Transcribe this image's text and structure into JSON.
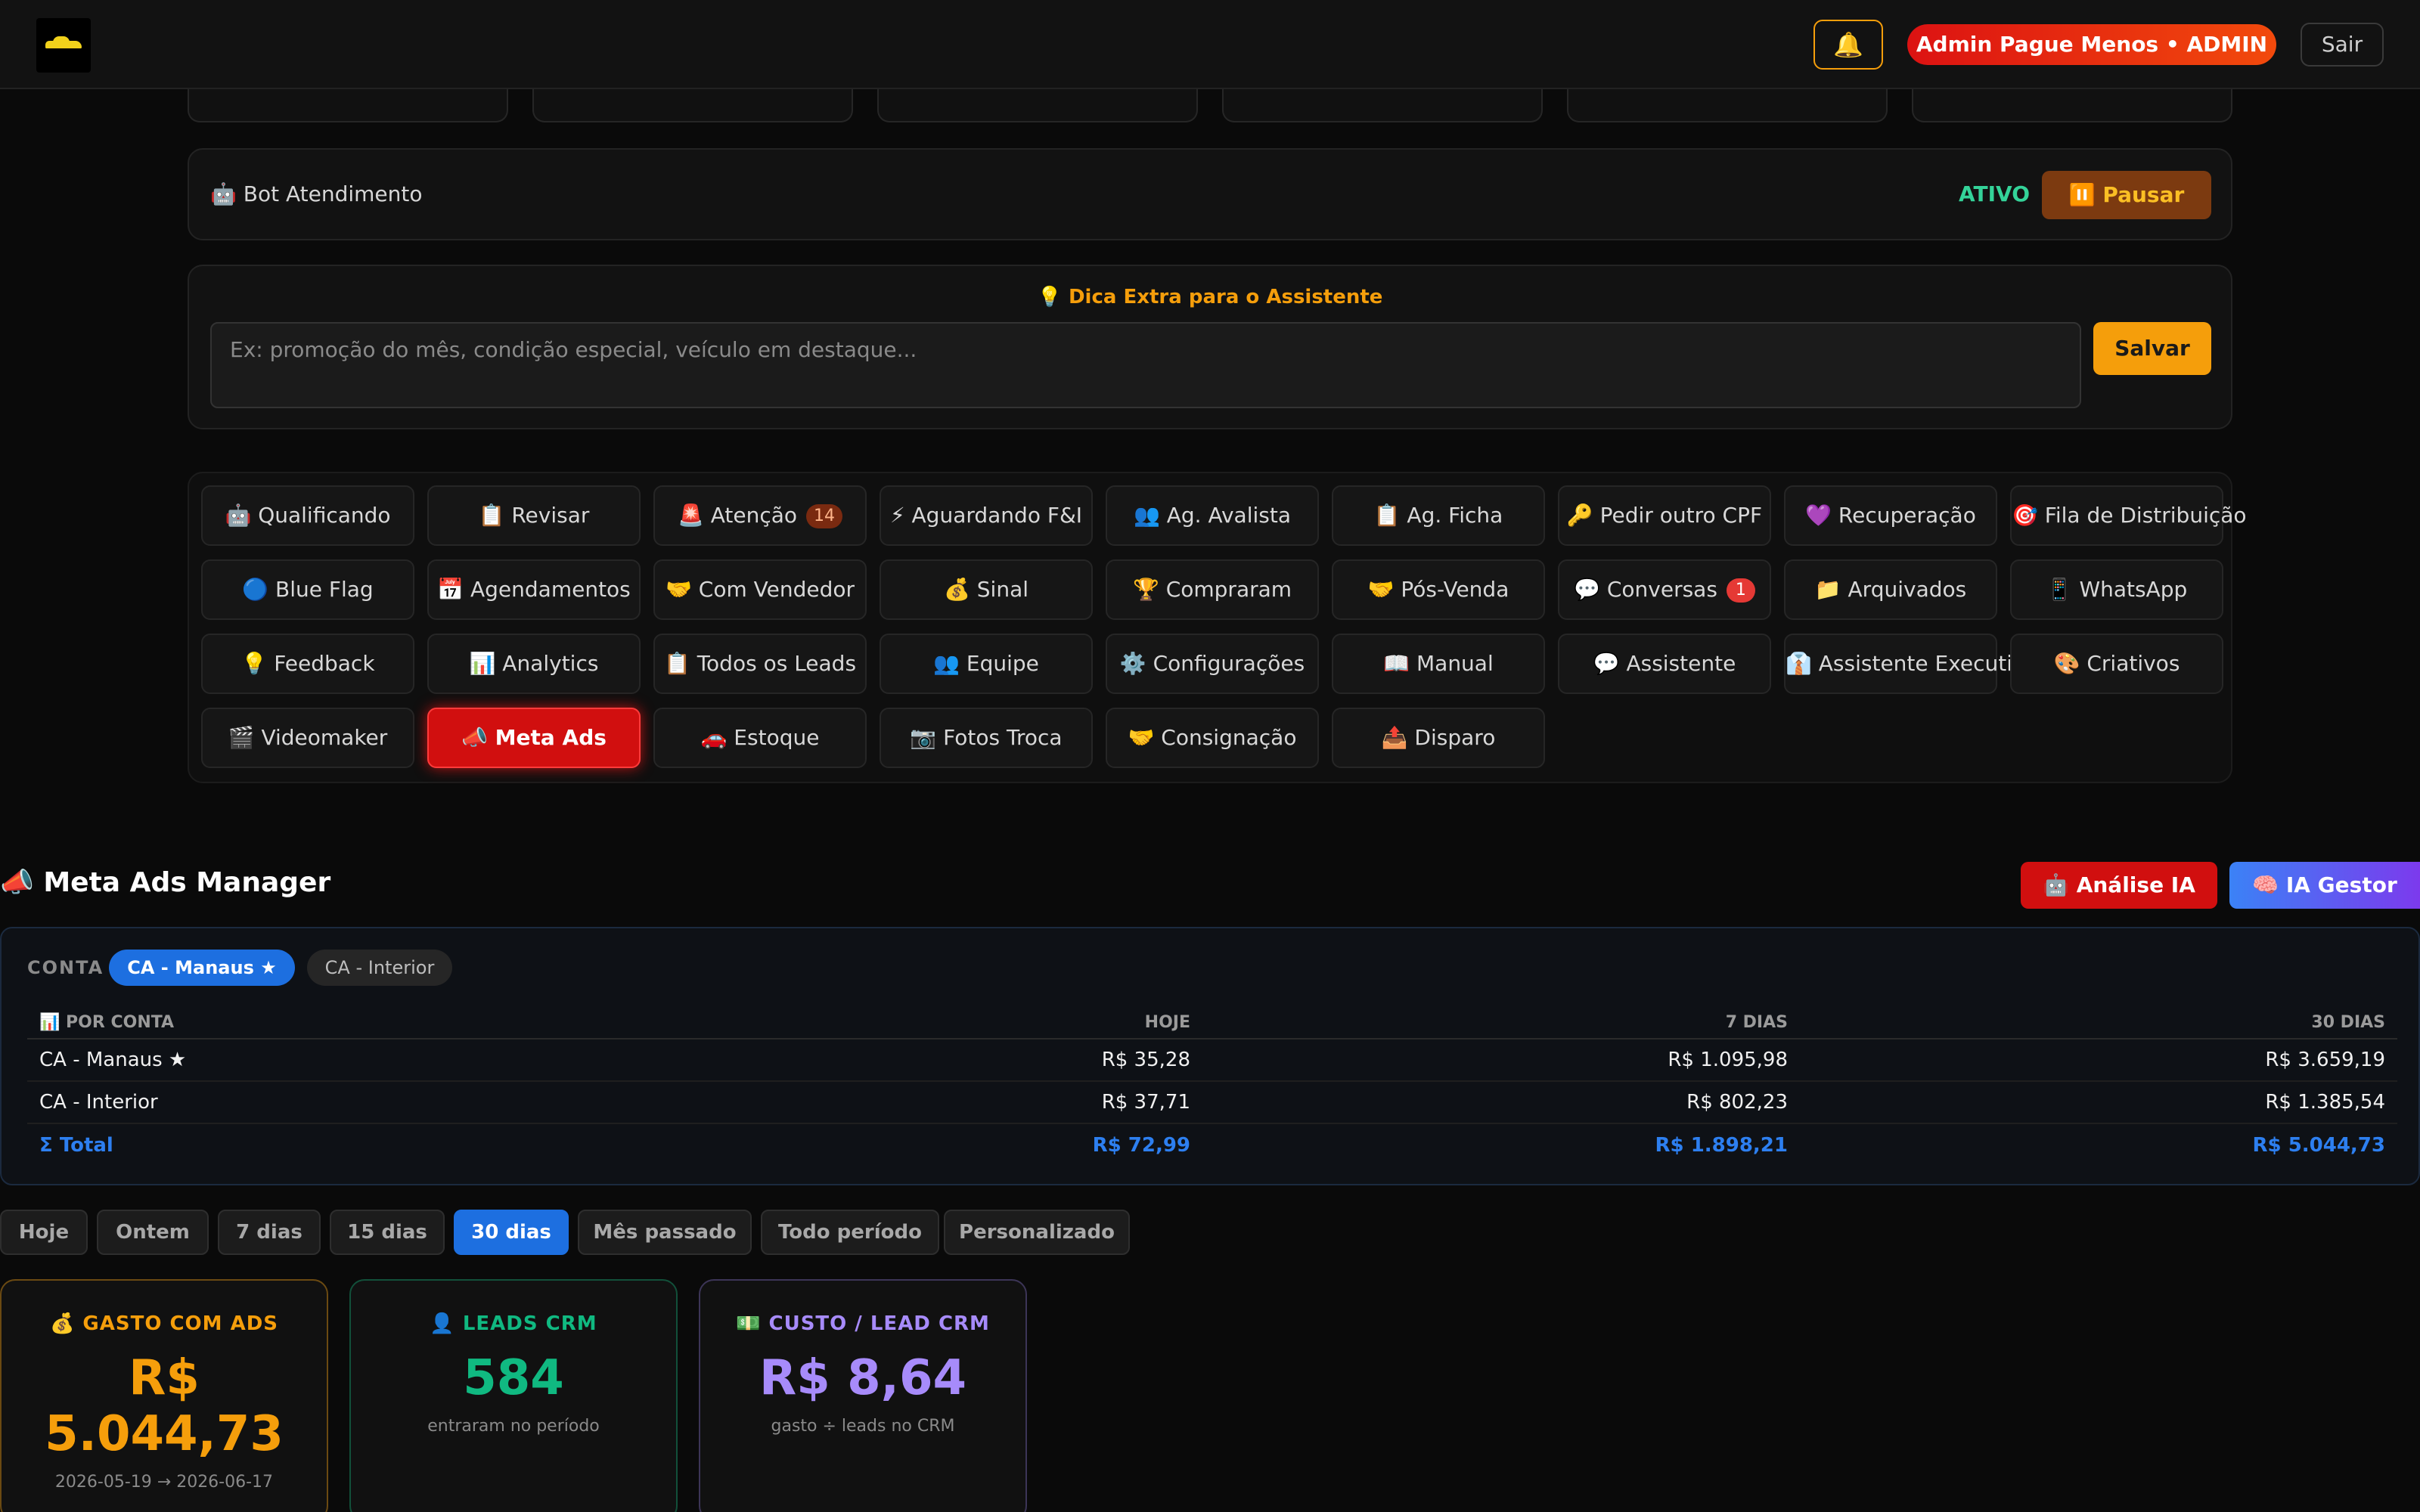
{
  "header": {
    "bell_icon": "🔔",
    "user_label": "Admin Pague Menos • ADMIN",
    "logout_label": "Sair"
  },
  "bot": {
    "label": "🤖 Bot Atendimento",
    "status": "ATIVO",
    "pause_label": "⏸️ Pausar"
  },
  "tip": {
    "title": "💡 Dica Extra para o Assistente",
    "placeholder": "Ex: promoção do mês, condição especial, veículo em destaque...",
    "save_label": "Salvar"
  },
  "nav": [
    {
      "label": "🤖 Qualificando"
    },
    {
      "label": "📋 Revisar"
    },
    {
      "label": "🚨 Atenção",
      "badge": "14"
    },
    {
      "label": "⚡ Aguardando F&I"
    },
    {
      "label": "👥 Ag. Avalista"
    },
    {
      "label": "📋 Ag. Ficha"
    },
    {
      "label": "🔑 Pedir outro CPF"
    },
    {
      "label": "💜 Recuperação"
    },
    {
      "label": "🎯 Fila de Distribuição"
    },
    {
      "label": "🔵 Blue Flag"
    },
    {
      "label": "📅 Agendamentos"
    },
    {
      "label": "🤝 Com Vendedor"
    },
    {
      "label": "💰 Sinal"
    },
    {
      "label": "🏆 Compraram"
    },
    {
      "label": "🤝 Pós-Venda"
    },
    {
      "label": "💬 Conversas",
      "badge": "1"
    },
    {
      "label": "📁 Arquivados"
    },
    {
      "label": "📱 WhatsApp"
    },
    {
      "label": "💡 Feedback"
    },
    {
      "label": "📊 Analytics"
    },
    {
      "label": "📋 Todos os Leads"
    },
    {
      "label": "👥 Equipe"
    },
    {
      "label": "⚙️ Configurações"
    },
    {
      "label": "📖 Manual"
    },
    {
      "label": "💬 Assistente"
    },
    {
      "label": "👔 Assistente Executivo"
    },
    {
      "label": "🎨 Criativos"
    },
    {
      "label": "🎬 Videomaker"
    },
    {
      "label": "📣 Meta Ads",
      "active": true
    },
    {
      "label": "🚗 Estoque"
    },
    {
      "label": "📷 Fotos Troca"
    },
    {
      "label": "🤝 Consignação"
    },
    {
      "label": "📤 Disparo"
    }
  ],
  "meta": {
    "title": "📣 Meta Ads Manager",
    "ai_analysis_label": "🤖 Análise IA",
    "ai_manager_label": "🧠 IA Gestor"
  },
  "accounts": {
    "label": "CONTA",
    "chips": [
      "CA - Manaus ★",
      "CA - Interior"
    ],
    "table": {
      "headers": [
        "📊 POR CONTA",
        "HOJE",
        "7 DIAS",
        "30 DIAS"
      ],
      "rows": [
        [
          "CA - Manaus ★",
          "R$ 35,28",
          "R$ 1.095,98",
          "R$ 3.659,19"
        ],
        [
          "CA - Interior",
          "R$ 37,71",
          "R$ 802,23",
          "R$ 1.385,54"
        ]
      ],
      "total": [
        "Σ Total",
        "R$ 72,99",
        "R$ 1.898,21",
        "R$ 5.044,73"
      ]
    }
  },
  "periods": [
    "Hoje",
    "Ontem",
    "7 dias",
    "15 dias",
    "30 dias",
    "Mês passado",
    "Todo período",
    "Personalizado"
  ],
  "selected_period": "30 dias",
  "stats": {
    "gasto": {
      "title": "💰 GASTO COM ADS",
      "value": "R$ 5.044,73",
      "sub": "2026-05-19 → 2026-06-17"
    },
    "leads": {
      "title": "👤 LEADS CRM",
      "value": "584",
      "sub": "entraram no período"
    },
    "cpl": {
      "title": "💵 CUSTO / LEAD CRM",
      "value": "R$ 8,64",
      "sub": "gasto ÷ leads no CRM"
    }
  },
  "colors": {
    "accent_red": "#d10f0f",
    "accent_blue": "#1d6fe0",
    "amber": "#f59e0b",
    "green": "#10b981",
    "purple": "#a78bfa"
  }
}
